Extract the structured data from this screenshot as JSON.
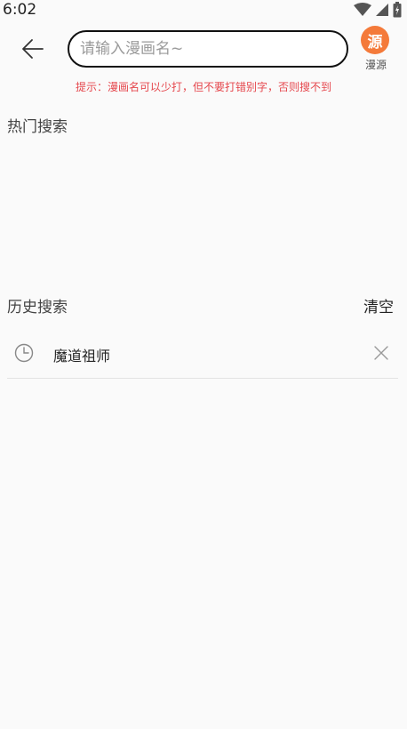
{
  "status_bar": {
    "time": "6:02",
    "icons": [
      "wifi-icon",
      "cellular-signal-icon",
      "battery-icon"
    ]
  },
  "search": {
    "placeholder": "请输入漫画名~",
    "value": ""
  },
  "source": {
    "badge": "源",
    "label": "漫源",
    "color": "#f47a3a"
  },
  "hint": "提示：漫画名可以少打，但不要打错别字，否则搜不到",
  "hot_search": {
    "title": "热门搜索"
  },
  "history": {
    "title": "历史搜索",
    "clear_label": "清空",
    "items": [
      {
        "label": "魔道祖师"
      }
    ]
  },
  "colors": {
    "hint": "#e5474d",
    "background": "#fafafa"
  }
}
